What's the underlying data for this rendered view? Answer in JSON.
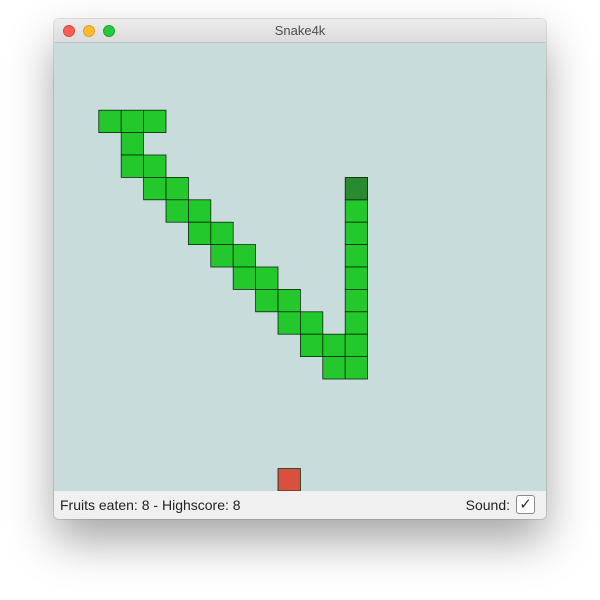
{
  "window": {
    "title": "Snake4k"
  },
  "game": {
    "colors": {
      "background": "#c8dcdc",
      "snake_body": "#22c82c",
      "snake_head": "#2a8a32",
      "fruit": "#d9503c",
      "outline": "#0a2a0a"
    },
    "snake_head": "head-segment",
    "fruit": "fruit"
  },
  "status": {
    "fruits_label": "Fruits eaten:",
    "fruits": 8,
    "separator": "-",
    "highscore_label": "Highscore:",
    "highscore": 8,
    "sound_label": "Sound:",
    "sound_checked": true,
    "checkmark_icon": "checkmark-icon"
  }
}
